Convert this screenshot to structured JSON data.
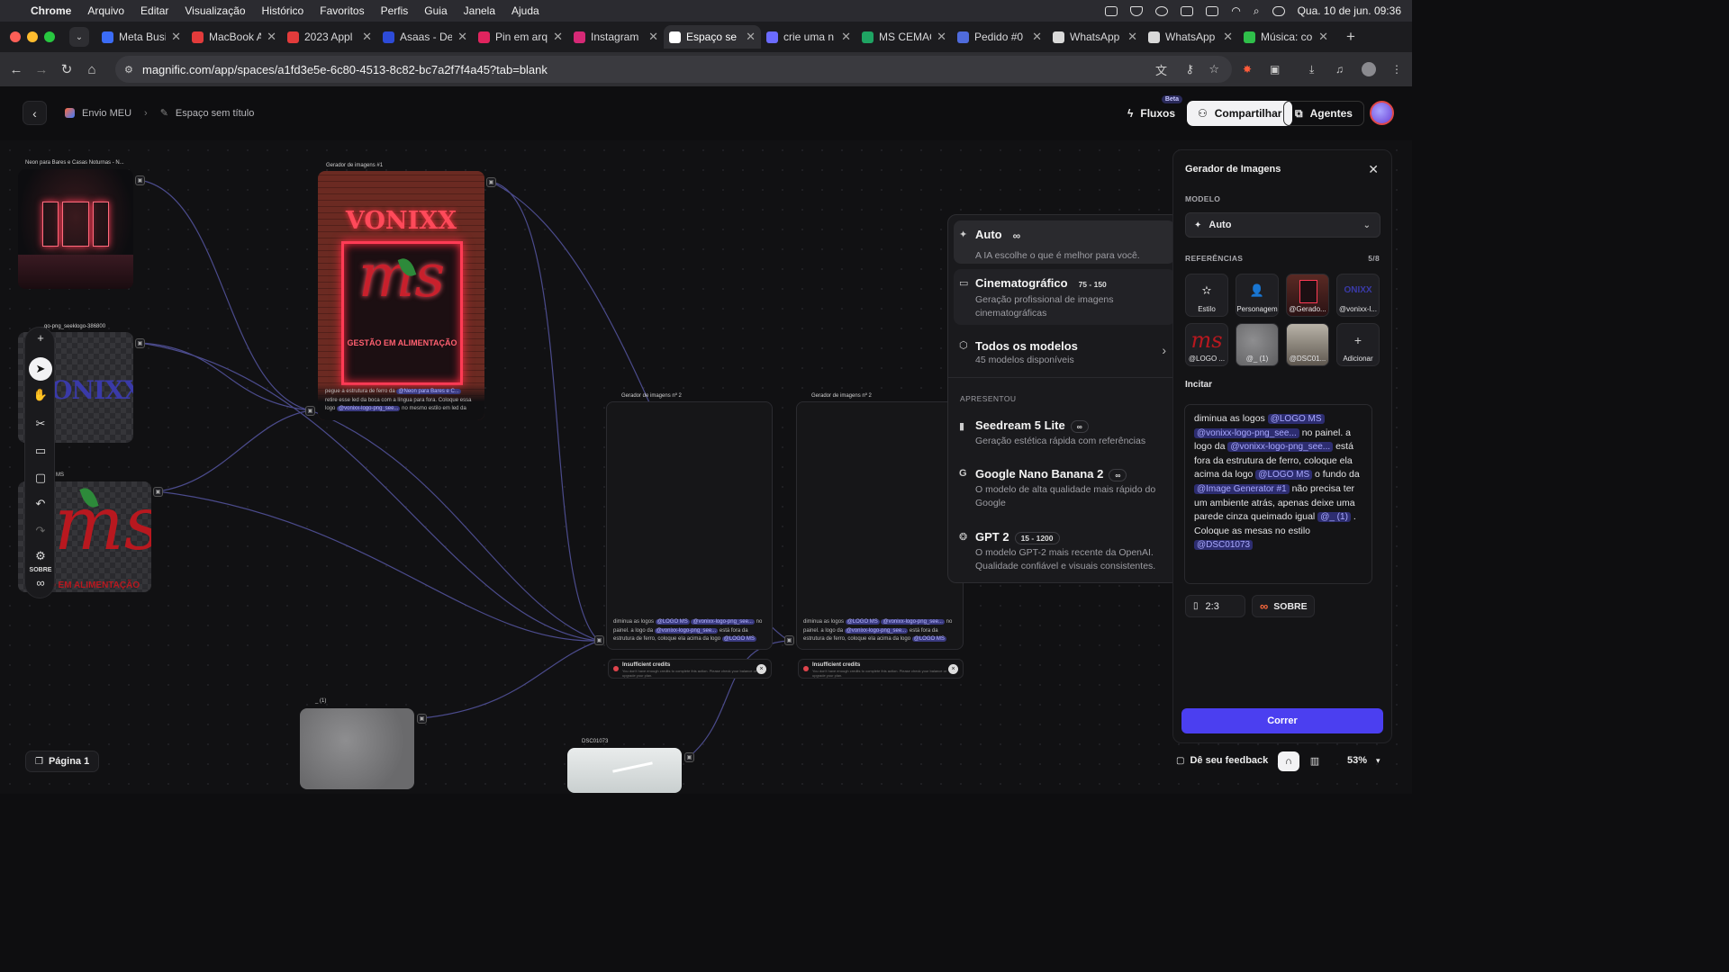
{
  "menubar": {
    "app": "Chrome",
    "items": [
      "Arquivo",
      "Editar",
      "Visualização",
      "Histórico",
      "Favoritos",
      "Perfis",
      "Guia",
      "Janela",
      "Ajuda"
    ],
    "clock": "Qua. 10 de jun.  09:36"
  },
  "tabs": [
    {
      "label": "Meta Busir",
      "color": "#3b6cf6"
    },
    {
      "label": "MacBook A",
      "color": "#e23b3b"
    },
    {
      "label": "2023 Appl",
      "color": "#e23b3b"
    },
    {
      "label": "Asaas - De",
      "color": "#2d4bd8"
    },
    {
      "label": "Pin em arq",
      "color": "#e0245e"
    },
    {
      "label": "Instagram",
      "color": "#d62976"
    },
    {
      "label": "Espaço se",
      "color": "#ffffff",
      "active": true
    },
    {
      "label": "crie uma n",
      "color": "#6b6bff"
    },
    {
      "label": "MS CEMAC",
      "color": "#1fa463"
    },
    {
      "label": "Pedido #0",
      "color": "#4f6bdc"
    },
    {
      "label": "WhatsApp",
      "color": "#d9d9d9"
    },
    {
      "label": "WhatsApp",
      "color": "#d9d9d9"
    },
    {
      "label": "Música: co",
      "color": "#2fbf4a"
    }
  ],
  "address": {
    "url": "magnific.com/app/spaces/a1fd3e5e-6c80-4513-8c82-bc7a2f7f4a45?tab=blank"
  },
  "header": {
    "breadcrumb_project": "Envio MEU",
    "breadcrumb_space": "Espaço sem título",
    "flows": "Fluxos",
    "flows_badge": "Beta",
    "share": "Compartilhar",
    "agents": "Agentes"
  },
  "canvas": {
    "node_neon_label": "Neon para Bares e Casas Noturnas - N...",
    "node_gen1_label": "Gerador de imagens #1",
    "gen1_sign": "VONIXX",
    "gen1_logo": "ms",
    "gen1_subtitle": "GESTÃO EM ALIMENTAÇÃO",
    "gen1_prompt_a": "pegue a estrutura de ferro da",
    "gen1_prompt_chip1": "@Neon para Bares e C...",
    "gen1_prompt_b": "retire esse led da boca com a língua para fora. Coloque essa logo",
    "gen1_prompt_chip2": "@vonixx-logo-png_see...",
    "gen1_prompt_c": "no mesmo estilo em led da",
    "node_vonixx_label": "...go-png_seeklogo-386800",
    "vonixx_text": "ONIXX",
    "node_ms_label": "MS",
    "ms_text": "ms",
    "ms_subtitle": "O EM ALIMENTAÇÃO",
    "node_gen2a_label": "Gerador de imagens nº 2",
    "node_gen2b_label": "Gerador de imagens nº 2",
    "gen2_prompt_a": "diminua as logos",
    "gen2_chip_logo": "@LOGO MS",
    "gen2_chip_vonixx": "@vonixx-logo-png_see...",
    "gen2_prompt_b": "no painel. a logo da",
    "gen2_prompt_c": "está fora da estrutura de ferro, coloque ela acima da logo",
    "error_title": "Insufficient credits",
    "error_body": "You don't have enough credits to complete this action. Please check your balance or upgrade your plan.",
    "node_concrete_label": "_ (1)",
    "node_dsc_label": "DSC01073",
    "page": "Página 1"
  },
  "tools": {
    "mode_badge": "SOBRE"
  },
  "model_menu": {
    "options": [
      {
        "title": "Auto",
        "desc": "A IA escolhe o que é melhor para você.",
        "badge": "∞"
      },
      {
        "title": "Cinematográfico",
        "desc": "Geração profissional de imagens cinematográficas",
        "badge": "75 - 150"
      },
      {
        "title": "Todos os modelos",
        "desc": "45 modelos disponíveis"
      }
    ],
    "featured_label": "APRESENTOU",
    "featured": [
      {
        "title": "Seedream 5 Lite",
        "desc": "Geração estética rápida com referências",
        "badge": "∞"
      },
      {
        "title": "Google Nano Banana 2",
        "desc": "O modelo de alta qualidade mais rápido do Google",
        "badge": "∞"
      },
      {
        "title": "GPT 2",
        "desc": "O modelo GPT-2 mais recente da OpenAI. Qualidade confiável e visuais consistentes.",
        "badge": "15 - 1200"
      }
    ]
  },
  "panel": {
    "title": "Gerador de Imagens",
    "model_label": "MODELO",
    "model_value": "Auto",
    "refs_label": "REFERÊNCIAS",
    "refs_count": "5/8",
    "refs": [
      "Estilo",
      "Personagem",
      "@Gerado...",
      "@vonixx-l...",
      "@LOGO ...",
      "@_ (1)",
      "@DSC01...",
      "Adicionar"
    ],
    "prompt_label": "Incitar",
    "prompt": {
      "p1": "diminua as logos",
      "c1": "@LOGO MS",
      "c2": "@vonixx-logo-png_see...",
      "p2": "no painel. a logo da",
      "c3": "@vonixx-logo-png_see...",
      "p3": "está fora da estrutura de ferro, coloque ela acima da logo",
      "c4": "@LOGO MS",
      "p4": "o fundo da",
      "c5": "@Image Generator #1",
      "p5": "não precisa ter um ambiente atrás, apenas deixe uma parede cinza queimado igual",
      "c6": "@_ (1)",
      "p6": ". Coloque as mesas no estilo",
      "c7": "@DSC01073"
    },
    "aspect": "2:3",
    "mode": "SOBRE",
    "run": "Correr"
  },
  "footer": {
    "feedback": "Dê seu feedback",
    "zoom": "53%"
  }
}
